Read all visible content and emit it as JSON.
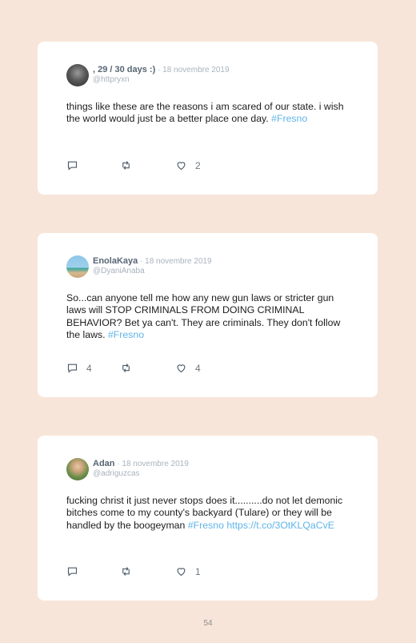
{
  "tweets": [
    {
      "name": ", 29 / 30 days :)",
      "date": " · 18 novembre 2019",
      "handle": "@httpryxn",
      "text": "things like these are the reasons i am scared of our state. i wish the world would just be a better place one day.",
      "hashtag": "#Fresno",
      "link": "",
      "replies": "",
      "likes": "2"
    },
    {
      "name": "EnolaKaya",
      "date": " · 18 novembre 2019",
      "handle": "@DyaniAnaba",
      "text": "So...can anyone tell me how any new gun laws or stricter gun laws will STOP CRIMINALS FROM DOING CRIMINAL BEHAVIOR? Bet ya can't. They are criminals. They don't follow the laws.",
      "hashtag": "#Fresno",
      "link": "",
      "replies": "4",
      "likes": "4"
    },
    {
      "name": "Adan",
      "date": " · 18 novembre 2019",
      "handle": "@adriguzcas",
      "text": "fucking christ it just never stops does it..........do not let demonic bitches come to my county's backyard (Tulare) or they will be handled by the boogeyman",
      "hashtag": "#Fresno",
      "link": "https://t.co/3OtKLQaCvE",
      "replies": "",
      "likes": "1"
    }
  ],
  "page_number": "54",
  "colors": {
    "background": "#f8e5da",
    "hashtag": "#5fb4e8",
    "name": "#566574",
    "meta": "#a9b3bc"
  },
  "icons": [
    "reply-icon",
    "retweet-icon",
    "like-icon"
  ]
}
